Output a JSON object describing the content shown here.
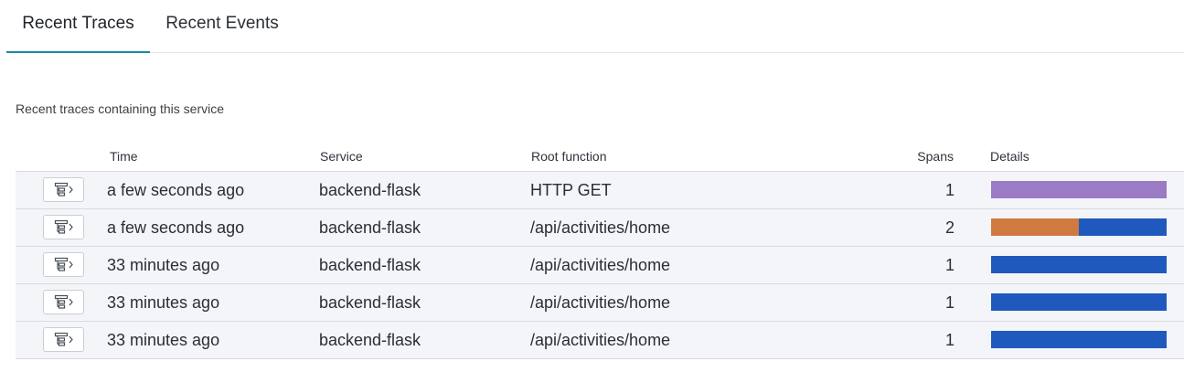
{
  "tabs": [
    {
      "label": "Recent Traces",
      "active": true
    },
    {
      "label": "Recent Events",
      "active": false
    }
  ],
  "subtitle": "Recent traces containing this service",
  "columns": {
    "time": "Time",
    "service": "Service",
    "root": "Root function",
    "spans": "Spans",
    "details": "Details"
  },
  "icons": {
    "trace_button": "trace-waterfall-icon"
  },
  "colors": {
    "purple": "#9b7bc4",
    "orange": "#cf7a41",
    "blue": "#2059bd"
  },
  "rows": [
    {
      "time": "a few seconds ago",
      "service": "backend-flask",
      "root": "HTTP GET",
      "spans": "1",
      "details": [
        {
          "share": 1.0,
          "color": "#9b7bc4"
        }
      ]
    },
    {
      "time": "a few seconds ago",
      "service": "backend-flask",
      "root": "/api/activities/home",
      "spans": "2",
      "details": [
        {
          "share": 0.5,
          "color": "#cf7a41"
        },
        {
          "share": 0.5,
          "color": "#2059bd"
        }
      ]
    },
    {
      "time": "33 minutes ago",
      "service": "backend-flask",
      "root": "/api/activities/home",
      "spans": "1",
      "details": [
        {
          "share": 1.0,
          "color": "#2059bd"
        }
      ]
    },
    {
      "time": "33 minutes ago",
      "service": "backend-flask",
      "root": "/api/activities/home",
      "spans": "1",
      "details": [
        {
          "share": 1.0,
          "color": "#2059bd"
        }
      ]
    },
    {
      "time": "33 minutes ago",
      "service": "backend-flask",
      "root": "/api/activities/home",
      "spans": "1",
      "details": [
        {
          "share": 1.0,
          "color": "#2059bd"
        }
      ]
    }
  ]
}
